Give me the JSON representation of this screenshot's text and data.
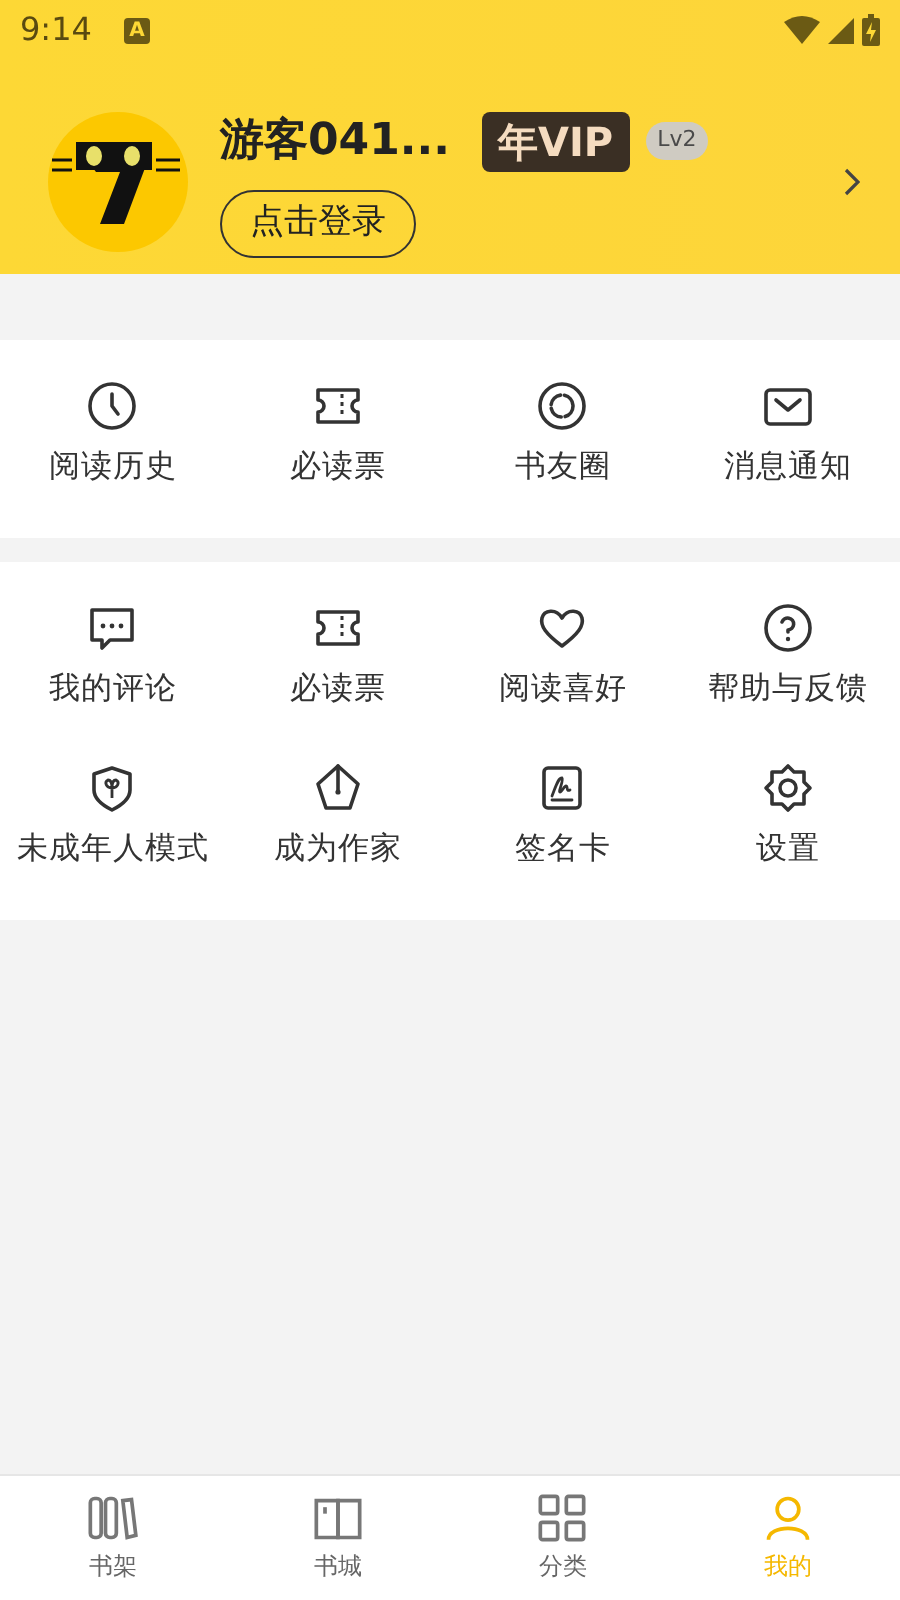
{
  "status_bar": {
    "time": "9:14",
    "notification": "A"
  },
  "profile": {
    "username": "游客041...",
    "vip": "年VIP",
    "level": "Lv2",
    "login": "点击登录"
  },
  "menu_sections": [
    {
      "items": [
        {
          "label": "阅读历史"
        },
        {
          "label": "必读票"
        },
        {
          "label": "书友圈"
        },
        {
          "label": "消息通知"
        }
      ]
    },
    {
      "items": [
        {
          "label": "我的评论"
        },
        {
          "label": "必读票"
        },
        {
          "label": "阅读喜好"
        },
        {
          "label": "帮助与反馈"
        },
        {
          "label": "未成年人模式"
        },
        {
          "label": "成为作家"
        },
        {
          "label": "签名卡"
        },
        {
          "label": "设置"
        }
      ]
    }
  ],
  "bottom_nav": [
    {
      "label": "书架",
      "selected": false
    },
    {
      "label": "书城",
      "selected": false
    },
    {
      "label": "分类",
      "selected": false
    },
    {
      "label": "我的",
      "selected": true
    }
  ]
}
